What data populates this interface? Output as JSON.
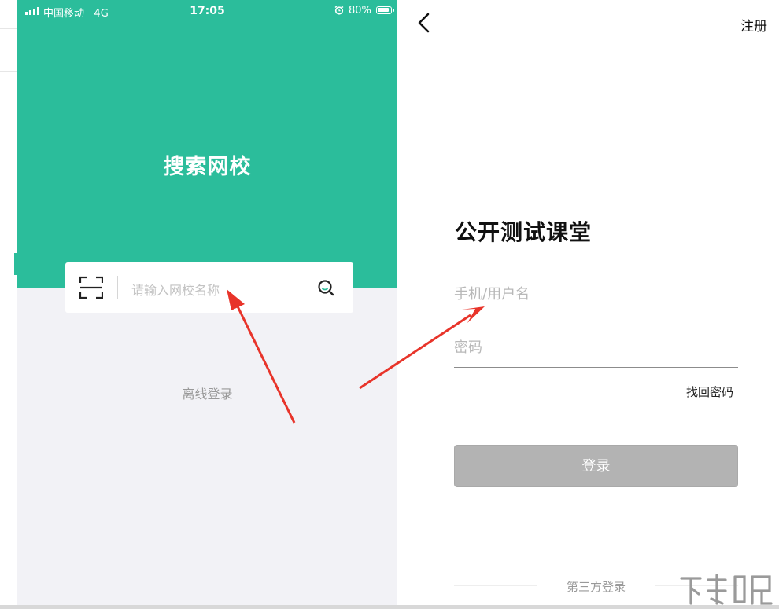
{
  "status_bar": {
    "carrier": "中国移动",
    "network": "4G",
    "time": "17:05",
    "battery": "80%"
  },
  "left_screen": {
    "title": "搜索网校",
    "search": {
      "placeholder": "请输入网校名称",
      "scan_icon": "scan-icon",
      "search_icon": "search-icon"
    },
    "offline_login": "离线登录"
  },
  "right_screen": {
    "back_icon": "chevron-left-icon",
    "register": "注册",
    "school_name": "公开测试课堂",
    "username_placeholder": "手机/用户名",
    "password_placeholder": "密码",
    "forgot_password": "找回密码",
    "login_button": "登录",
    "third_party_login": "第三方登录"
  },
  "annotations": {
    "arrow_color": "#e8342a"
  },
  "colors": {
    "brand_green": "#2bbd9b",
    "login_button_disabled": "#b3b3b3",
    "page_background": "#f2f2f6"
  }
}
